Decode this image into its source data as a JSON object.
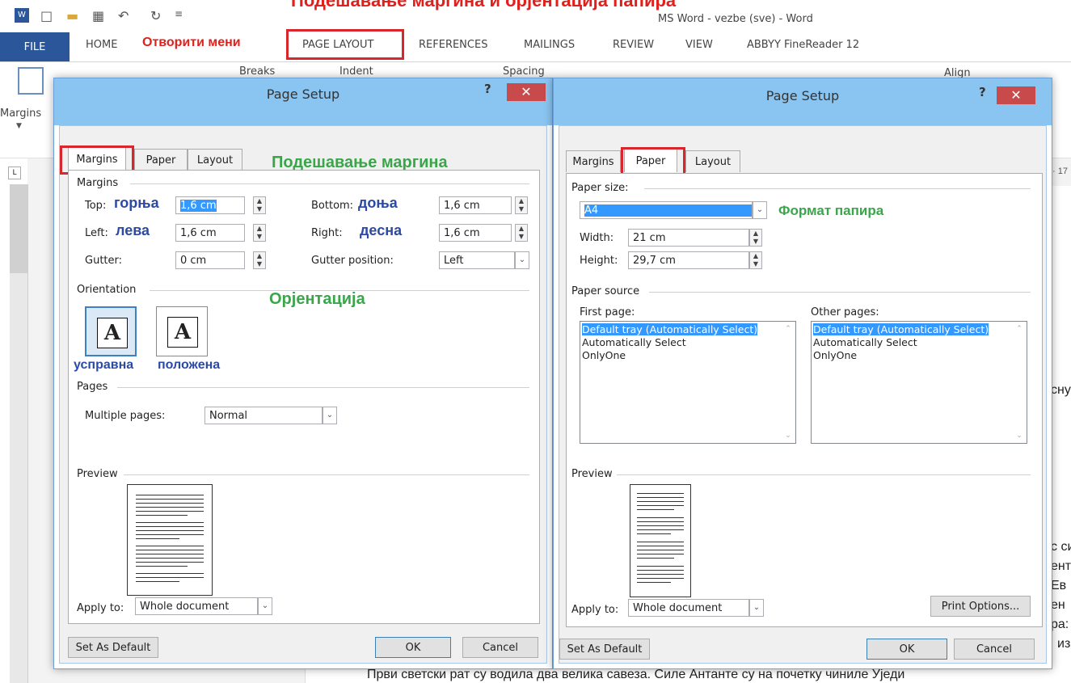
{
  "annotation": {
    "top_title": "Подешавање маргина и орјентација папира",
    "open_menu": "Отворити мени",
    "margins_setting": "Подешавање маргина",
    "orientation": "Орјентација",
    "paper_format": "Формат папира",
    "top": "горња",
    "bottom": "доња",
    "left": "лева",
    "right": "десна",
    "portrait": "усправна",
    "landscape": "положена"
  },
  "window": {
    "title": "MS Word - vezbe (sve) - Word"
  },
  "ribbon_tabs": {
    "file": "FILE",
    "home": "HOME",
    "page_layout": "PAGE LAYOUT",
    "references": "REFERENCES",
    "mailings": "MAILINGS",
    "review": "REVIEW",
    "view": "VIEW",
    "abbyy": "ABBYY FineReader 12"
  },
  "ribbon": {
    "margins": "Margins",
    "breaks": "Breaks",
    "indent": "Indent",
    "spacing": "Spacing",
    "align": "Align"
  },
  "dialog_left": {
    "title": "Page Setup",
    "help": "?",
    "tabs": [
      "Margins",
      "Paper",
      "Layout"
    ],
    "margins_section": "Margins",
    "top_label": "Top:",
    "top_value": "1,6 cm",
    "bottom_label": "Bottom:",
    "bottom_value": "1,6 cm",
    "left_label": "Left:",
    "left_value": "1,6 cm",
    "right_label": "Right:",
    "right_value": "1,6 cm",
    "gutter_label": "Gutter:",
    "gutter_value": "0 cm",
    "gutter_position_label": "Gutter position:",
    "gutter_position_value": "Left",
    "orientation_section": "Orientation",
    "pages_section": "Pages",
    "multiple_pages_label": "Multiple pages:",
    "multiple_pages_value": "Normal",
    "preview_section": "Preview",
    "apply_to_label": "Apply to:",
    "apply_to_value": "Whole document",
    "set_default": "Set As Default",
    "ok": "OK",
    "cancel": "Cancel"
  },
  "dialog_right": {
    "title": "Page Setup",
    "help": "?",
    "tabs": [
      "Margins",
      "Paper",
      "Layout"
    ],
    "paper_size_section": "Paper size:",
    "paper_size_value": "A4",
    "width_label": "Width:",
    "width_value": "21 cm",
    "height_label": "Height:",
    "height_value": "29,7 cm",
    "paper_source_section": "Paper source",
    "first_page_label": "First page:",
    "other_pages_label": "Other pages:",
    "first_page_items": [
      "Default tray (Automatically Select)",
      "Automatically Select",
      "OnlyOne"
    ],
    "other_pages_items": [
      "Default tray (Automatically Select)",
      "Automatically Select",
      "OnlyOne"
    ],
    "preview_section": "Preview",
    "apply_to_label": "Apply to:",
    "apply_to_value": "Whole document",
    "print_options": "Print Options...",
    "set_default": "Set As Default",
    "ok": "OK",
    "cancel": "Cancel"
  },
  "document": {
    "bottom_line": "Први светски рат су водила два велика савеза. Силе Антанте су на почетку чиниле Уједи",
    "frag1": "сну",
    "frag2": "с си",
    "frag3": "ент",
    "frag4": "Ев",
    "frag5": "ен",
    "frag6": "ра:",
    "frag7": "из",
    "ruler_right": "· 17"
  }
}
